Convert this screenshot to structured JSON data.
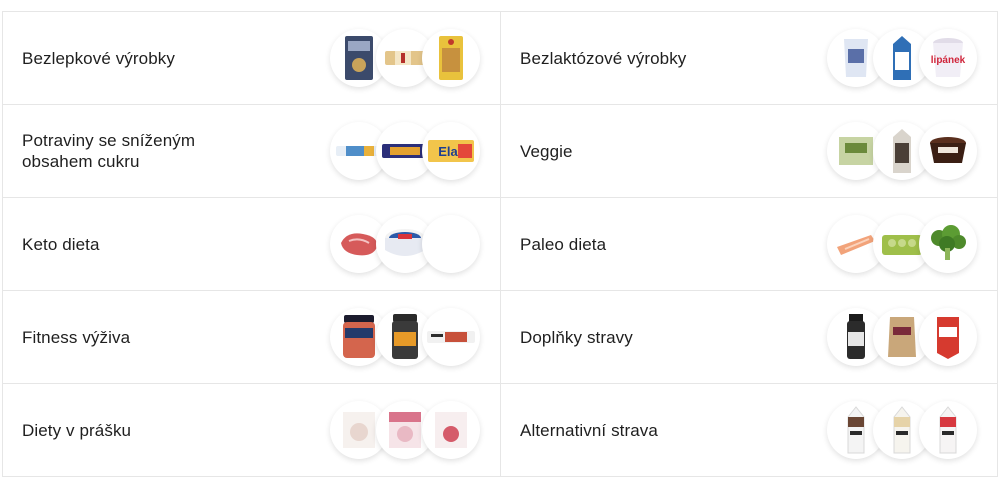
{
  "categories": [
    {
      "label": "Bezlepkové výrobky",
      "icons": [
        "gluten-free-cereal-box-icon",
        "wafer-bar-icon",
        "bread-package-icon"
      ]
    },
    {
      "label": "Bezlaktózové výrobky",
      "icons": [
        "lactose-free-yogurt-icon",
        "milk-carton-icon",
        "pudding-cup-icon"
      ]
    },
    {
      "label": "Potraviny se sníženým obsahem cukru",
      "icons": [
        "biscuit-pack-icon",
        "chocolate-bar-icon",
        "wafer-pack-icon"
      ]
    },
    {
      "label": "Veggie",
      "icons": [
        "veggie-pouch-icon",
        "plant-drink-carton-icon",
        "chocolate-dessert-icon"
      ]
    },
    {
      "label": "Keto dieta",
      "icons": [
        "raw-meat-icon",
        "cheese-tub-icon",
        "empty-icon"
      ]
    },
    {
      "label": "Paleo dieta",
      "icons": [
        "salmon-fillet-icon",
        "egg-carton-icon",
        "broccoli-icon"
      ]
    },
    {
      "label": "Fitness výživa",
      "icons": [
        "protein-spread-jar-icon",
        "supplement-tub-icon",
        "protein-bar-icon"
      ]
    },
    {
      "label": "Doplňky stravy",
      "icons": [
        "vitamin-bottle-icon",
        "powder-pouch-icon",
        "energy-gel-icon"
      ]
    },
    {
      "label": "Diety v prášku",
      "icons": [
        "diet-powder-box-icon",
        "diet-powder-box-pink-icon",
        "diet-powder-box-red-icon"
      ]
    },
    {
      "label": "Alternativní strava",
      "icons": [
        "meal-shake-chocolate-icon",
        "meal-shake-vanilla-icon",
        "meal-shake-strawberry-icon"
      ]
    }
  ]
}
